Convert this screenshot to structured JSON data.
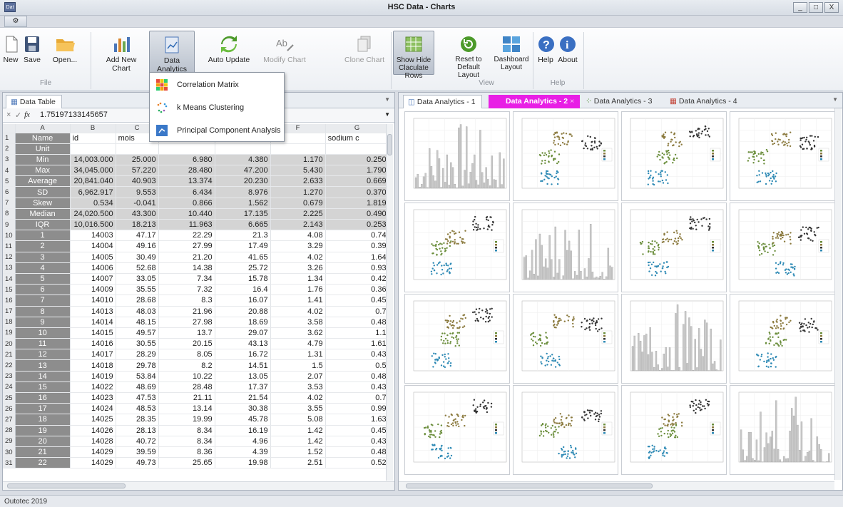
{
  "window": {
    "title": "HSC Data - Charts",
    "app_icon_text": "Dat",
    "controls": [
      "_",
      "□",
      "X"
    ]
  },
  "qat": {
    "icon": "gear-icon"
  },
  "ribbon": {
    "buttons": [
      {
        "id": "new",
        "label": "New",
        "icon": "new-document-icon"
      },
      {
        "id": "save",
        "label": "Save",
        "icon": "save-icon"
      },
      {
        "id": "open",
        "label": "Open...",
        "icon": "folder-open-icon"
      },
      {
        "id": "add_chart",
        "label": "Add New Chart",
        "icon": "bar-chart-icon"
      },
      {
        "id": "analytics",
        "label": "Data Analytics",
        "icon": "analytics-icon"
      },
      {
        "id": "auto_update",
        "label": "Auto Update",
        "icon": "refresh-icon"
      },
      {
        "id": "modify",
        "label": "Modify Chart",
        "icon": "text-edit-icon"
      },
      {
        "id": "clone",
        "label": "Clone Chart",
        "icon": "clone-icon"
      },
      {
        "id": "show_hide",
        "label": "Show Hide Claculate Rows",
        "icon": "grid-icon"
      },
      {
        "id": "reset",
        "label": "Reset to Default Layout",
        "icon": "reset-icon"
      },
      {
        "id": "dashboard",
        "label": "Dashboard Layout",
        "icon": "dashboard-icon"
      },
      {
        "id": "help",
        "label": "Help",
        "icon": "help-icon"
      },
      {
        "id": "about",
        "label": "About",
        "icon": "info-icon"
      }
    ],
    "groups": {
      "file": "File",
      "view": "View",
      "help": "Help"
    }
  },
  "dropdown": {
    "items": [
      {
        "label": "Correlation Matrix",
        "icon": "matrix-icon"
      },
      {
        "label": "k Means Clustering",
        "icon": "cluster-icon"
      },
      {
        "label": "Principal Component Analysis",
        "icon": "pca-icon"
      }
    ]
  },
  "left_panel": {
    "tab": "Data Table",
    "formula": {
      "cancel": "×",
      "confirm": "✓",
      "fx": "fx",
      "value": "1.75197133145657"
    },
    "columns": [
      "",
      "A",
      "B",
      "C",
      "D",
      "E",
      "F",
      "G"
    ],
    "header_row": {
      "A": "Name",
      "B": "id",
      "C": "mois",
      "F": "sh",
      "G": "sodium",
      "H": "c"
    },
    "unit_label": "Unit",
    "stats": [
      {
        "label": "Min",
        "values": [
          "14,003.000",
          "25.000",
          "6.980",
          "4.380",
          "1.170",
          "0.250"
        ]
      },
      {
        "label": "Max",
        "values": [
          "34,045.000",
          "57.220",
          "28.480",
          "47.200",
          "5.430",
          "1.790"
        ]
      },
      {
        "label": "Average",
        "values": [
          "20,841.040",
          "40.903",
          "13.374",
          "20.230",
          "2.633",
          "0.669"
        ]
      },
      {
        "label": "SD",
        "values": [
          "6,962.917",
          "9.553",
          "6.434",
          "8.976",
          "1.270",
          "0.370"
        ]
      },
      {
        "label": "Skew",
        "values": [
          "0.534",
          "-0.041",
          "0.866",
          "1.562",
          "0.679",
          "1.819"
        ]
      },
      {
        "label": "Median",
        "values": [
          "24,020.500",
          "43.300",
          "10.440",
          "17.135",
          "2.225",
          "0.490"
        ]
      },
      {
        "label": "IQR",
        "values": [
          "10,016.500",
          "18.213",
          "11.963",
          "6.665",
          "2.143",
          "0.253"
        ]
      }
    ],
    "rows": [
      [
        "1",
        "14003",
        "47.17",
        "22.29",
        "21.3",
        "4.08",
        "0.74"
      ],
      [
        "2",
        "14004",
        "49.16",
        "27.99",
        "17.49",
        "3.29",
        "0.39"
      ],
      [
        "3",
        "14005",
        "30.49",
        "21.20",
        "41.65",
        "4.02",
        "1.64"
      ],
      [
        "4",
        "14006",
        "52.68",
        "14.38",
        "25.72",
        "3.26",
        "0.93"
      ],
      [
        "5",
        "14007",
        "33.05",
        "7.34",
        "15.78",
        "1.34",
        "0.42"
      ],
      [
        "6",
        "14009",
        "35.55",
        "7.32",
        "16.4",
        "1.76",
        "0.36"
      ],
      [
        "7",
        "14010",
        "28.68",
        "8.3",
        "16.07",
        "1.41",
        "0.45"
      ],
      [
        "8",
        "14013",
        "48.03",
        "21.96",
        "20.88",
        "4.02",
        "0.7"
      ],
      [
        "9",
        "14014",
        "48.15",
        "27.98",
        "18.69",
        "3.58",
        "0.48"
      ],
      [
        "10",
        "14015",
        "49.57",
        "13.7",
        "29.07",
        "3.62",
        "1.1"
      ],
      [
        "11",
        "14016",
        "30.55",
        "20.15",
        "43.13",
        "4.79",
        "1.61"
      ],
      [
        "12",
        "14017",
        "28.29",
        "8.05",
        "16.72",
        "1.31",
        "0.43"
      ],
      [
        "13",
        "14018",
        "29.78",
        "8.2",
        "14.51",
        "1.5",
        "0.5"
      ],
      [
        "14",
        "14019",
        "53.84",
        "10.22",
        "13.05",
        "2.07",
        "0.48"
      ],
      [
        "15",
        "14022",
        "48.69",
        "28.48",
        "17.37",
        "3.53",
        "0.43"
      ],
      [
        "16",
        "14023",
        "47.53",
        "21.11",
        "21.54",
        "4.02",
        "0.7"
      ],
      [
        "17",
        "14024",
        "48.53",
        "13.14",
        "30.38",
        "3.55",
        "0.99"
      ],
      [
        "18",
        "14025",
        "28.35",
        "19.99",
        "45.78",
        "5.08",
        "1.63"
      ],
      [
        "19",
        "14026",
        "28.13",
        "8.34",
        "16.19",
        "1.42",
        "0.45"
      ],
      [
        "20",
        "14028",
        "40.72",
        "8.34",
        "4.96",
        "1.42",
        "0.43"
      ],
      [
        "21",
        "14029",
        "39.59",
        "8.36",
        "4.39",
        "1.52",
        "0.48"
      ],
      [
        "22",
        "14029",
        "49.73",
        "25.65",
        "19.98",
        "2.51",
        "0.52"
      ]
    ]
  },
  "right_panel": {
    "tabs": [
      "Data Analytics - 1",
      "Data Analytics - 2",
      "Data Analytics - 3",
      "Data Analytics - 4"
    ],
    "active_tab": "Data Analytics - 2"
  },
  "colors": {
    "cluster": [
      "#6b8e3c",
      "#8b7a3e",
      "#333333",
      "#2e8ab5"
    ],
    "histogram": "#c8c8c8",
    "magenta": "#e81fe5"
  },
  "statusbar": {
    "text": "Outotec 2019"
  }
}
